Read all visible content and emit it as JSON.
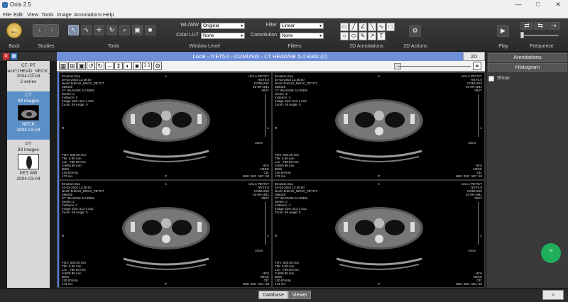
{
  "window": {
    "title": "Onis 2.5",
    "minimize": "—",
    "maximize": "□",
    "close": "✕"
  },
  "menu": [
    "File",
    "Edit",
    "View",
    "Tools",
    "Image",
    "Annotations",
    "Help"
  ],
  "toolbar": {
    "back_label": "Back",
    "studies_label": "Studies",
    "tools_label": "Tools",
    "window_level_label": "Window Level",
    "filters_label": "Filters",
    "annotations_label": "2D Annotations",
    "actions_label": "2D Actions",
    "play_label": "Play",
    "frequence_label": "Frequence",
    "wlww_label": "WL/WW",
    "wlww_value": "Original",
    "color_lut_label": "Color LUT",
    "color_lut_value": "None",
    "filter_label": "Filter",
    "filter_value": "Linear",
    "convolution_label": "Convolution",
    "convolution_value": "None"
  },
  "viewer_title": "Local - IYET5.0 - COMUNIX - CT HEAD/NK 5.0 B30s (2)",
  "mode_tab": "2D",
  "zoom_ratio": "1:1",
  "study": {
    "patient": "CT, PT",
    "description": "Neck^1HEAD_NECK_...",
    "date": "2004-03-04",
    "series_count": "2 series"
  },
  "series": [
    {
      "modality": "CT",
      "images": "83 images",
      "label": "NECK",
      "date": "2004-03-04"
    },
    {
      "modality": "PT",
      "images": "83 images",
      "label": "PET WB",
      "date": "2004-03-04"
    }
  ],
  "overlay": {
    "tl": "Emotion Duo\n04-03-2004 12:36:00\nNeck^1HEAD_NECK_PETCT\n396429\nCT HEAD/NK 5.0 B30s\nSeries: 2\nInstance: 3\nImage Size: 512 x 512\nZoom: 49 Angle: 0",
    "tr": "UCLA PET/CT\nIYET5.0\nCOMUNIX\n01-09-1941\n062Y",
    "bl": "FOV: 500.00 mm\nThk: 5.00 mm\nLoc: -780.00 mm\n0.98/0.98 mm\nB30s\n130.00 kVp\n173 mA",
    "br": "HFS\nNECK\nCE:\nWW: 250 : WC: 50",
    "orient_top": "A",
    "orient_bottom": "P",
    "orient_left": "R",
    "orient_right": "L",
    "scale": "10cm"
  },
  "overlay_bottom": [
    {
      "tl": "Emotion Duo\n04-03-2004 12:36:00\nNeck^1HEAD_NECK_PETCT\n396429\nCT HEAD/NK 5.0 B30s\nSeries: 2\nInstance: 2\nImage Size: 512 x 512\nZoom: 49 Angle: 0",
      "bl": "FOV: 500.00 mm\nThk: 5.00 mm\nLoc: -785.00 mm\n0.98/0.98 mm\nB30s\n130.00 kVp\n173 mA",
      "br": "HFS\nNECK\nCE:\nWW: 250 : WC: 50"
    },
    {
      "tl": "Emotion Duo\n04-03-2004 12:36:00\nNeck^1HEAD_NECK_PETCT\n396429\nCT HEAD/NK 5.0 B30s\nSeries: 2\nInstance: 4\nImage Size: 512 x 512\nZoom: 49 Angle: 0",
      "bl": "FOV: 500.00 mm\nThk: 5.00 mm\nLoc: -785.00 mm\n0.98/0.98 mm\nB30s\n130.00 kVp\n173 mA",
      "br": "HFS\nNECK\nCE:\nWW: 250 : WC: 50"
    }
  ],
  "right_panel": {
    "annotations": "Annotations",
    "histogram": "Histogram",
    "show": "Show"
  },
  "bottom": {
    "database": "Database",
    "viewer": "Viewer",
    "next": ">"
  },
  "colors": {
    "accent": "#6f8fd8",
    "selected": "#5b8fc7",
    "fab": "#1fae5a"
  }
}
